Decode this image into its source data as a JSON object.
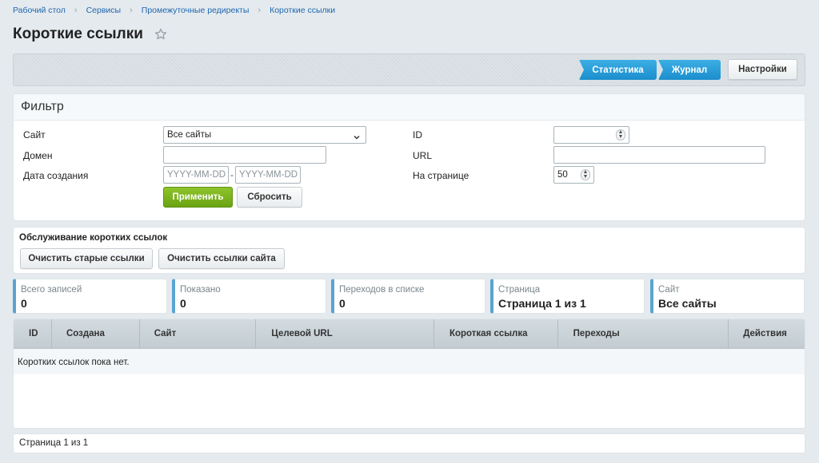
{
  "breadcrumbs": [
    "Рабочий стол",
    "Сервисы",
    "Промежуточные редиректы",
    "Короткие ссылки"
  ],
  "page": {
    "title": "Короткие ссылки"
  },
  "toolbar": {
    "stats_label": "Статистика",
    "journal_label": "Журнал",
    "settings_label": "Настройки"
  },
  "filter": {
    "title": "Фильтр",
    "site_label": "Сайт",
    "site_value": "Все сайты",
    "domain_label": "Домен",
    "domain_value": "",
    "created_label": "Дата создания",
    "date_from_placeholder": "YYYY-MM-DD",
    "date_to_placeholder": "YYYY-MM-DD",
    "date_sep": "-",
    "id_label": "ID",
    "id_value": "",
    "url_label": "URL",
    "url_value": "",
    "per_page_label": "На странице",
    "per_page_value": "50",
    "apply_label": "Применить",
    "reset_label": "Сбросить"
  },
  "maintenance": {
    "title": "Обслуживание коротких ссылок",
    "clear_old_label": "Очистить старые ссылки",
    "clear_site_label": "Очистить ссылки сайта"
  },
  "stats": [
    {
      "label": "Всего записей",
      "value": "0"
    },
    {
      "label": "Показано",
      "value": "0"
    },
    {
      "label": "Переходов в списке",
      "value": "0"
    },
    {
      "label": "Страница",
      "value": "Страница 1 из 1"
    },
    {
      "label": "Сайт",
      "value": "Все сайты"
    }
  ],
  "table": {
    "columns": [
      "ID",
      "Создана",
      "Сайт",
      "Целевой URL",
      "Короткая ссылка",
      "Переходы",
      "Действия"
    ],
    "empty_text": "Коротких ссылок пока нет."
  },
  "pager": {
    "text": "Страница 1 из 1"
  },
  "colors": {
    "accent_blue": "#2c9fd8",
    "apply_green": "#7bb51f",
    "link": "#2067b0"
  }
}
